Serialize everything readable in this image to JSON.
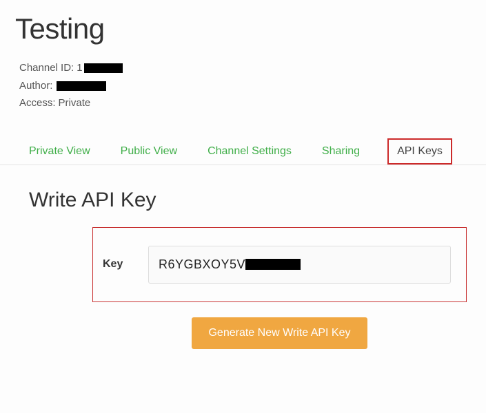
{
  "page": {
    "title": "Testing"
  },
  "meta": {
    "channel_id_label": "Channel ID:",
    "channel_id_prefix": "1",
    "author_label": "Author:",
    "access_label": "Access:",
    "access_value": "Private"
  },
  "tabs": {
    "private_view": "Private View",
    "public_view": "Public View",
    "channel_settings": "Channel Settings",
    "sharing": "Sharing",
    "api_keys": "API Keys"
  },
  "section": {
    "title": "Write API Key",
    "key_label": "Key",
    "key_value_visible": "R6YGBXOY5V",
    "generate_button": "Generate New Write API Key"
  }
}
